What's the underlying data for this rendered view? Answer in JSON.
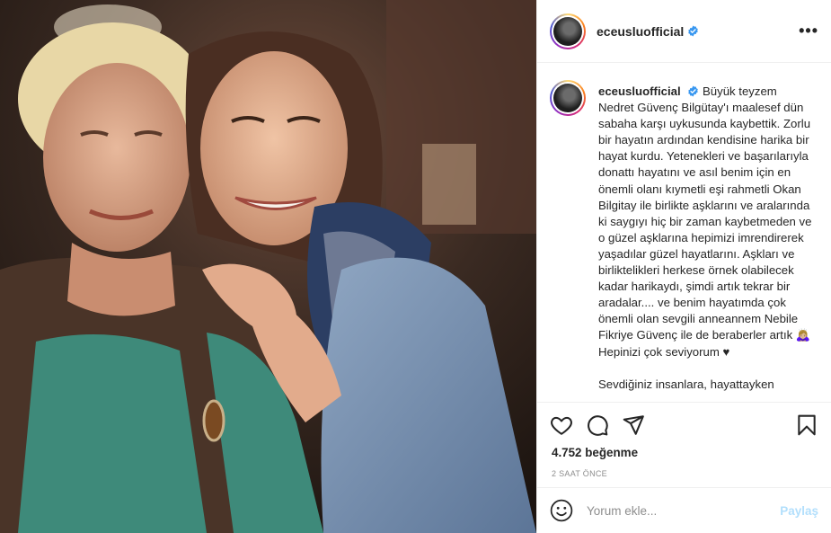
{
  "post": {
    "username": "eceusluofficial",
    "more_label": "•••",
    "caption": {
      "username": "eceusluofficial",
      "text": "Büyük teyzem Nedret Güvenç Bilgütay'ı maalesef dün sabaha karşı uykusunda kaybettik. Zorlu bir hayatın ardından kendisine harika bir hayat kurdu. Yetenekleri ve başarılarıyla donattı hayatını ve asıl benim için en önemli olanı kıymetli eşi rahmetli Okan Bilgitay ile birlikte aşklarını ve aralarında ki saygıyı hiç bir zaman kaybetmeden ve o güzel aşklarına hepimizi imrendirerek yaşadılar güzel hayatlarını. Aşkları ve birliktelikleri herkese örnek olabilecek kadar harikaydı, şimdi artık tekrar bir aradalar.... ve benim hayatımda çok önemli olan sevgili anneannem Nebile Fikriye Güvenç ile de beraberler artık 🙇🏼‍♀️ Hepinizi çok seviyorum ♥",
      "overflow_text": "Sevdiğiniz insanlara, hayattayken"
    },
    "likes": "4.752 beğenme",
    "time": "2 SAAT ÖNCE",
    "comment": {
      "placeholder": "Yorum ekle...",
      "post_label": "Paylaş"
    }
  },
  "colors": {
    "verified": "#3897f0",
    "post_button_disabled": "#b2dffc",
    "meta_text": "#8e8e8e",
    "border": "#efefef"
  },
  "icons": [
    "verified-badge-icon",
    "more-options-icon",
    "heart-icon",
    "comment-icon",
    "share-icon",
    "bookmark-icon",
    "emoji-icon"
  ]
}
